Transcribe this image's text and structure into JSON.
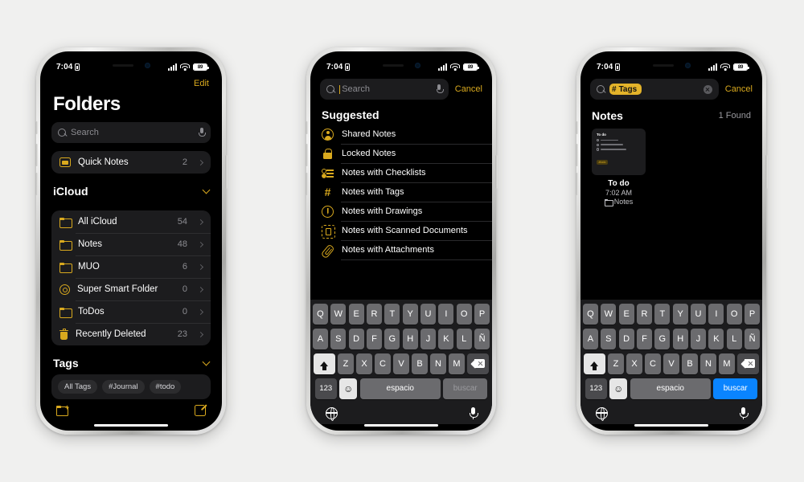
{
  "status_bar": {
    "time": "7:04",
    "battery_level": "89",
    "lock_icon": "lock-portrait-icon",
    "signal_icon": "cellular-bars-icon",
    "wifi_icon": "wifi-icon"
  },
  "phone1": {
    "edit_label": "Edit",
    "title": "Folders",
    "search": {
      "placeholder": "Search",
      "search_icon": "search-icon",
      "mic_icon": "microphone-icon"
    },
    "quick_notes": {
      "label": "Quick Notes",
      "count": "2",
      "icon": "quick-notes-icon"
    },
    "sections": [
      {
        "header": "iCloud",
        "items": [
          {
            "label": "All iCloud",
            "count": "54",
            "icon": "folder-icon"
          },
          {
            "label": "Notes",
            "count": "48",
            "icon": "folder-icon"
          },
          {
            "label": "MUO",
            "count": "6",
            "icon": "folder-icon"
          },
          {
            "label": "Super Smart Folder",
            "count": "0",
            "icon": "gear-icon"
          },
          {
            "label": "ToDos",
            "count": "0",
            "icon": "folder-icon"
          },
          {
            "label": "Recently Deleted",
            "count": "23",
            "icon": "trash-icon"
          }
        ]
      }
    ],
    "tags_section": {
      "header": "Tags",
      "chips": [
        "All Tags",
        "#Journal",
        "#todo"
      ]
    },
    "toolbar": {
      "new_folder_icon": "new-folder-icon",
      "compose_icon": "compose-note-icon"
    }
  },
  "phone2": {
    "search": {
      "value": "",
      "placeholder": "Search",
      "search_icon": "search-icon",
      "mic_icon": "microphone-icon"
    },
    "cancel_label": "Cancel",
    "suggested_title": "Suggested",
    "suggested": [
      {
        "label": "Shared Notes",
        "icon": "person-circle-icon"
      },
      {
        "label": "Locked Notes",
        "icon": "lock-icon"
      },
      {
        "label": "Notes with Checklists",
        "icon": "checklist-icon"
      },
      {
        "label": "Notes with Tags",
        "icon": "hashtag-icon"
      },
      {
        "label": "Notes with Drawings",
        "icon": "drawing-pencil-circle-icon"
      },
      {
        "label": "Notes with Scanned Documents",
        "icon": "scanner-icon"
      },
      {
        "label": "Notes with Attachments",
        "icon": "paperclip-icon"
      }
    ],
    "keyboard": {
      "row1": [
        "Q",
        "W",
        "E",
        "R",
        "T",
        "Y",
        "U",
        "I",
        "O",
        "P"
      ],
      "row2": [
        "A",
        "S",
        "D",
        "F",
        "G",
        "H",
        "J",
        "K",
        "L",
        "Ñ"
      ],
      "row3": [
        "Z",
        "X",
        "C",
        "V",
        "B",
        "N",
        "M"
      ],
      "shift_icon": "shift-up-icon",
      "delete_icon": "backspace-delete-icon",
      "numbers_label": "123",
      "emoji_icon": "emoji-smiley-icon",
      "space_label": "espacio",
      "return_label": "buscar",
      "return_enabled": false,
      "globe_icon": "globe-language-icon",
      "dictation_icon": "microphone-icon"
    }
  },
  "phone3": {
    "search": {
      "token_hash": "#",
      "token_label": "Tags",
      "clear_icon": "clear-circle-icon",
      "search_icon": "search-icon"
    },
    "cancel_label": "Cancel",
    "results_header": {
      "title": "Notes",
      "count_label": "1 Found"
    },
    "note": {
      "title": "To do",
      "time": "7:02 AM",
      "folder": "Notes",
      "folder_icon": "folder-icon",
      "thumbnail": {
        "title": "To do",
        "checklist_items": [
          "Wake up",
          "Eat breakfast",
          "Go back to bed"
        ],
        "tag_badge": "#todo"
      }
    },
    "keyboard": {
      "row1": [
        "Q",
        "W",
        "E",
        "R",
        "T",
        "Y",
        "U",
        "I",
        "O",
        "P"
      ],
      "row2": [
        "A",
        "S",
        "D",
        "F",
        "G",
        "H",
        "J",
        "K",
        "L",
        "Ñ"
      ],
      "row3": [
        "Z",
        "X",
        "C",
        "V",
        "B",
        "N",
        "M"
      ],
      "shift_icon": "shift-up-icon",
      "delete_icon": "backspace-delete-icon",
      "numbers_label": "123",
      "emoji_icon": "emoji-smiley-icon",
      "space_label": "espacio",
      "return_label": "buscar",
      "return_enabled": true,
      "globe_icon": "globe-language-icon",
      "dictation_icon": "microphone-icon"
    }
  },
  "colors": {
    "accent_gold": "#d9a91e",
    "accent_blue": "#0a84ff",
    "token_bg": "#e3b32a",
    "background": "#f0f0ef",
    "screen_bg": "#000000",
    "card_bg": "#1c1c1e"
  }
}
